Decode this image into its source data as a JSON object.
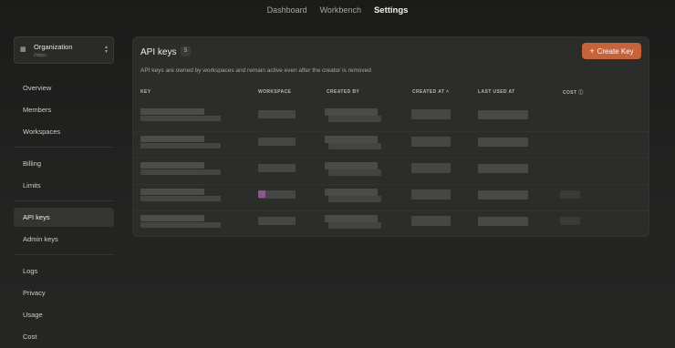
{
  "top_nav": {
    "tabs": [
      {
        "label": "Dashboard",
        "active": false
      },
      {
        "label": "Workbench",
        "active": false
      },
      {
        "label": "Settings",
        "active": true
      }
    ]
  },
  "sidebar": {
    "org": {
      "name": "Organization",
      "sub": "//ddpu",
      "icon": "building-icon"
    },
    "group1": [
      {
        "label": "Overview"
      },
      {
        "label": "Members"
      },
      {
        "label": "Workspaces"
      }
    ],
    "group2": [
      {
        "label": "Billing"
      },
      {
        "label": "Limits"
      }
    ],
    "group3": [
      {
        "label": "API keys",
        "active": true
      },
      {
        "label": "Admin keys"
      }
    ],
    "group4": [
      {
        "label": "Logs"
      },
      {
        "label": "Privacy"
      },
      {
        "label": "Usage"
      },
      {
        "label": "Cost"
      }
    ]
  },
  "main": {
    "title": "API keys",
    "count": "5",
    "create_button": "Create Key",
    "description": "API keys are owned by workspaces and remain active even after the creator is removed",
    "columns": {
      "key": "KEY",
      "workspace": "WORKSPACE",
      "created_by": "CREATED BY",
      "created_at": "CREATED AT",
      "last_used_at": "LAST USED AT",
      "cost": "COST"
    }
  },
  "colors": {
    "accent": "#c4633c",
    "background": "#1f1f1e",
    "panel": "#2c2c2a"
  }
}
